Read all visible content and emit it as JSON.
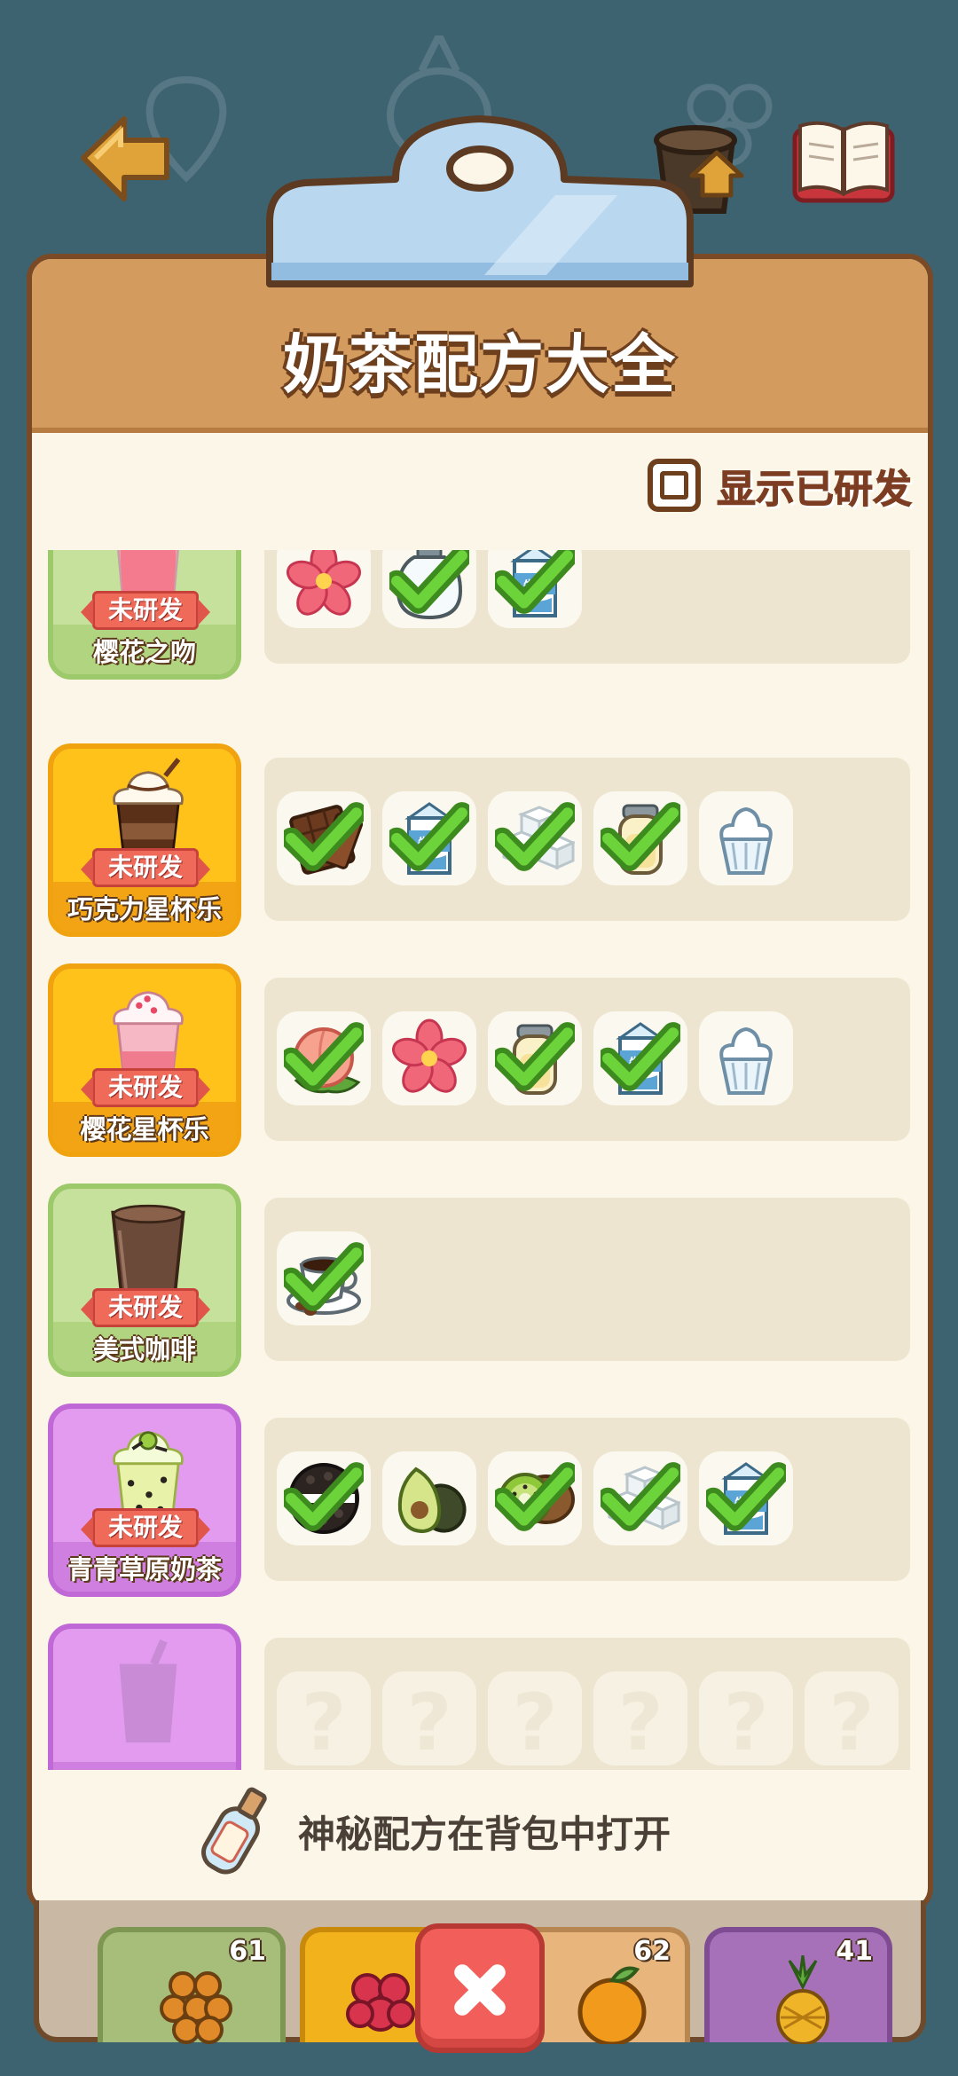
{
  "title": "奶茶配方大全",
  "toggle": {
    "label": "显示已研发",
    "checked": false
  },
  "recipes": [
    {
      "name": "樱花之吻",
      "status": "未研发",
      "card_color": "green",
      "drink": "sakura-kiss-drink-icon",
      "ingredients": [
        {
          "icon": "sakura-flower-icon",
          "checked": false
        },
        {
          "icon": "syrup-jar-icon",
          "checked": true
        },
        {
          "icon": "milk-carton-icon",
          "checked": true,
          "label": "牛奶"
        }
      ]
    },
    {
      "name": "巧克力星杯乐",
      "status": "未研发",
      "card_color": "yellow",
      "drink": "chocolate-frappe-drink-icon",
      "ingredients": [
        {
          "icon": "chocolate-bar-icon",
          "checked": true
        },
        {
          "icon": "milk-carton-icon",
          "checked": true,
          "label": "牛奶"
        },
        {
          "icon": "sugar-cubes-icon",
          "checked": true
        },
        {
          "icon": "condensed-milk-jar-icon",
          "checked": true
        },
        {
          "icon": "whipped-cream-icon",
          "checked": false
        }
      ]
    },
    {
      "name": "樱花星杯乐",
      "status": "未研发",
      "card_color": "yellow",
      "drink": "sakura-frappe-drink-icon",
      "ingredients": [
        {
          "icon": "peach-icon",
          "checked": true
        },
        {
          "icon": "sakura-flower-icon",
          "checked": false
        },
        {
          "icon": "condensed-milk-jar-icon",
          "checked": true
        },
        {
          "icon": "milk-carton-icon",
          "checked": true,
          "label": "牛奶"
        },
        {
          "icon": "whipped-cream-icon",
          "checked": false
        }
      ]
    },
    {
      "name": "美式咖啡",
      "status": "未研发",
      "card_color": "green",
      "drink": "americano-drink-icon",
      "ingredients": [
        {
          "icon": "coffee-cup-icon",
          "checked": true
        }
      ]
    },
    {
      "name": "青青草原奶茶",
      "status": "未研发",
      "card_color": "purple",
      "drink": "green-meadow-drink-icon",
      "ingredients": [
        {
          "icon": "oreo-cookie-icon",
          "checked": true
        },
        {
          "icon": "avocado-icon",
          "checked": false
        },
        {
          "icon": "kiwi-icon",
          "checked": true
        },
        {
          "icon": "sugar-cubes-icon",
          "checked": true
        },
        {
          "icon": "milk-carton-icon",
          "checked": true,
          "label": "牛奶"
        }
      ]
    },
    {
      "name": "",
      "status": "",
      "card_color": "purple",
      "drink": "locked-drink-icon",
      "ingredients": [
        {
          "icon": "unknown-icon",
          "label": "?"
        },
        {
          "icon": "unknown-icon",
          "label": "?"
        },
        {
          "icon": "unknown-icon",
          "label": "?"
        },
        {
          "icon": "unknown-icon",
          "label": "?"
        },
        {
          "icon": "unknown-icon",
          "label": "?"
        },
        {
          "icon": "unknown-icon",
          "label": "?"
        }
      ]
    }
  ],
  "hint": "神秘配方在背包中打开",
  "tray": [
    {
      "icon": "sea-buckthorn-icon",
      "count": "61",
      "color": "#a6be7a"
    },
    {
      "icon": "raspberry-icon",
      "count": "",
      "color": "#f2b21c"
    },
    {
      "icon": "orange-icon",
      "count": "62",
      "color": "#e8b57d"
    },
    {
      "icon": "pineapple-icon",
      "count": "41",
      "color": "#a771b9"
    }
  ]
}
